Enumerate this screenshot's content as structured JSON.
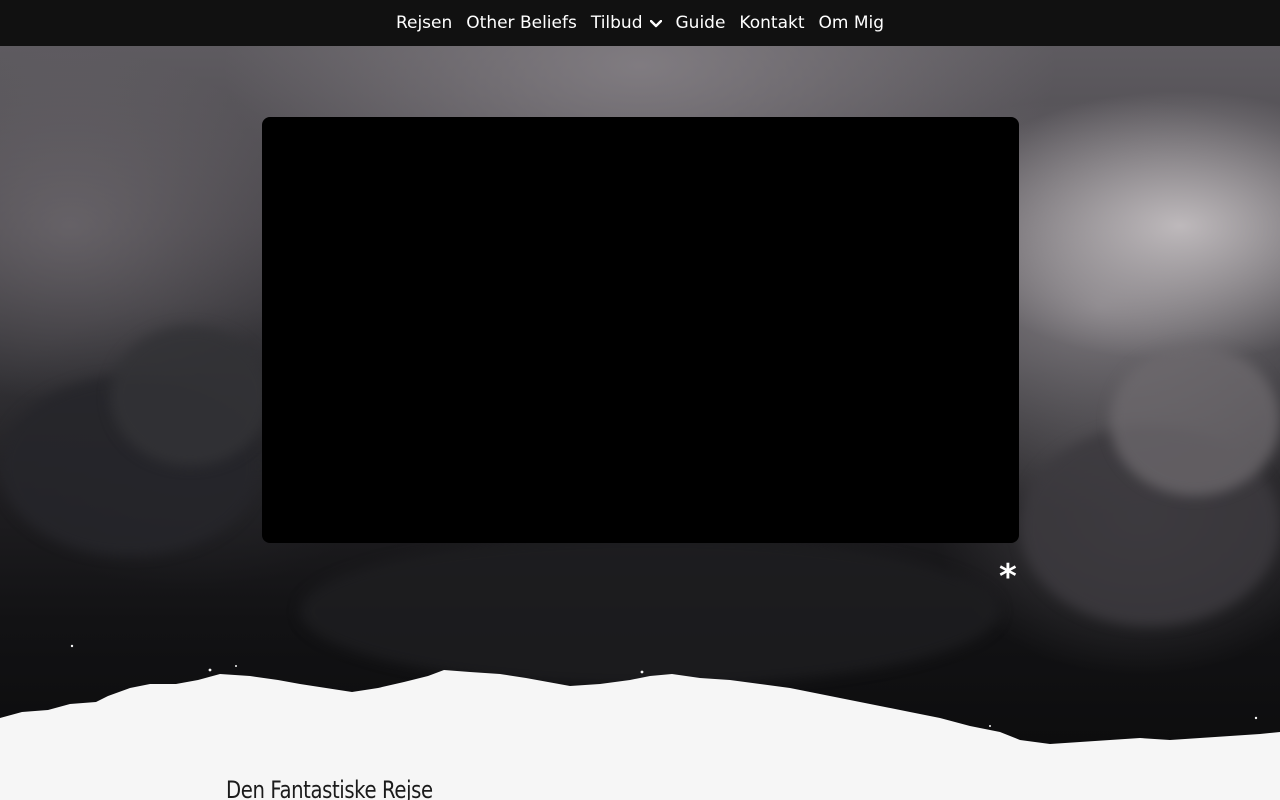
{
  "nav": {
    "items": [
      {
        "label": "Rejsen",
        "has_dropdown": false
      },
      {
        "label": "Other Beliefs",
        "has_dropdown": false
      },
      {
        "label": "Tilbud",
        "has_dropdown": true,
        "dropdown_icon": "chevron-down-icon"
      },
      {
        "label": "Guide",
        "has_dropdown": false
      },
      {
        "label": "Kontakt",
        "has_dropdown": false
      },
      {
        "label": "Om Mig",
        "has_dropdown": false
      }
    ]
  },
  "hero": {
    "background": "storm-clouds",
    "marker": "*"
  },
  "content": {
    "section_title": "Den Fantastiske Rejse"
  },
  "colors": {
    "nav_bg": "#111111",
    "nav_text": "#ffffff",
    "video_bg": "#000000",
    "page_bg": "#f6f6f6",
    "title_text": "#1b1b1b"
  }
}
